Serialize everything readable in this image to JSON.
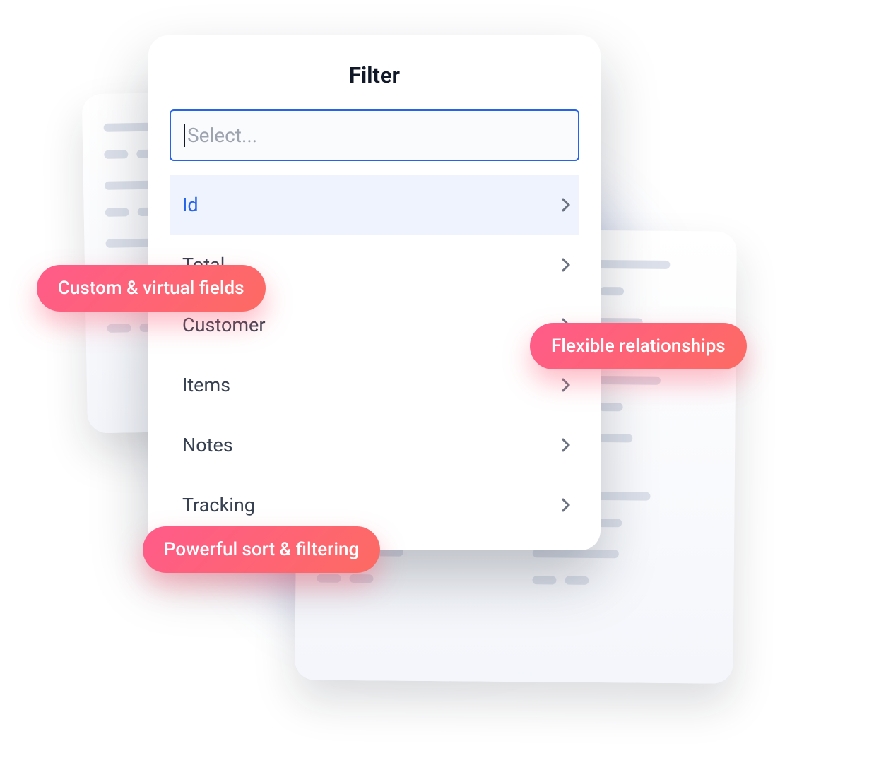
{
  "filter": {
    "title": "Filter",
    "placeholder": "Select...",
    "options": [
      {
        "label": "Id",
        "selected": true
      },
      {
        "label": "Total",
        "selected": false
      },
      {
        "label": "Customer",
        "selected": false
      },
      {
        "label": "Items",
        "selected": false
      },
      {
        "label": "Notes",
        "selected": false
      },
      {
        "label": "Tracking",
        "selected": false
      }
    ]
  },
  "badges": {
    "custom": "Custom & virtual fields",
    "flexible": "Flexible relationships",
    "powerful": "Powerful sort & filtering"
  }
}
